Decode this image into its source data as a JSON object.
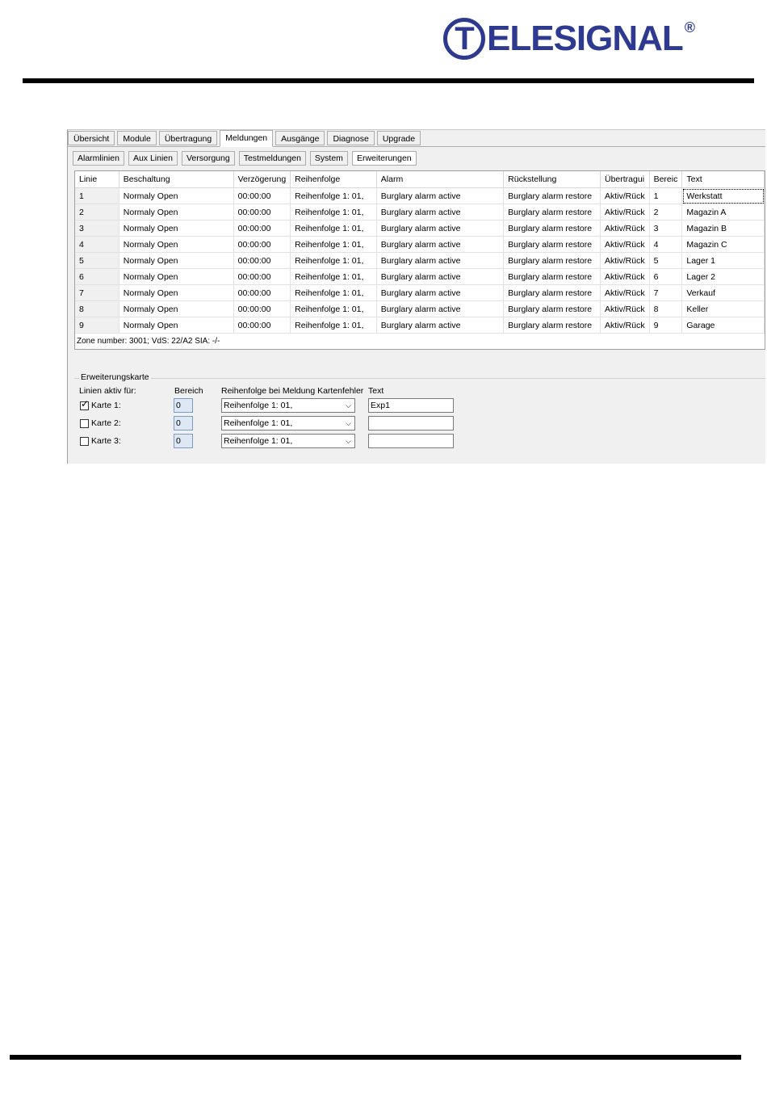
{
  "logo": {
    "letter": "T",
    "rest": "ELESIGNAL",
    "reg": "®"
  },
  "tabs_main": [
    {
      "label": "Übersicht",
      "active": false
    },
    {
      "label": "Module",
      "active": false
    },
    {
      "label": "Übertragung",
      "active": false
    },
    {
      "label": "Meldungen",
      "active": true
    },
    {
      "label": "Ausgänge",
      "active": false
    },
    {
      "label": "Diagnose",
      "active": false
    },
    {
      "label": "Upgrade",
      "active": false
    }
  ],
  "tabs_sub": [
    {
      "label": "Alarmlinien",
      "active": false
    },
    {
      "label": "Aux Linien",
      "active": false
    },
    {
      "label": "Versorgung",
      "active": false
    },
    {
      "label": "Testmeldungen",
      "active": false
    },
    {
      "label": "System",
      "active": false
    },
    {
      "label": "Erweiterungen",
      "active": true
    }
  ],
  "grid": {
    "columns": [
      "Linie",
      "Beschaltung",
      "Verzögerung",
      "Reihenfolge",
      "Alarm",
      "Rückstellung",
      "Übertragui",
      "Bereic",
      "Text"
    ],
    "rows": [
      [
        "1",
        "Normaly Open",
        "00:00:00",
        "Reihenfolge 1: 01,",
        "Burglary alarm active",
        "Burglary alarm restore",
        "Aktiv/Rück",
        "1",
        "Werkstatt"
      ],
      [
        "2",
        "Normaly Open",
        "00:00:00",
        "Reihenfolge 1: 01,",
        "Burglary alarm active",
        "Burglary alarm restore",
        "Aktiv/Rück",
        "2",
        "Magazin A"
      ],
      [
        "3",
        "Normaly Open",
        "00:00:00",
        "Reihenfolge 1: 01,",
        "Burglary alarm active",
        "Burglary alarm restore",
        "Aktiv/Rück",
        "3",
        "Magazin B"
      ],
      [
        "4",
        "Normaly Open",
        "00:00:00",
        "Reihenfolge 1: 01,",
        "Burglary alarm active",
        "Burglary alarm restore",
        "Aktiv/Rück",
        "4",
        "Magazin C"
      ],
      [
        "5",
        "Normaly Open",
        "00:00:00",
        "Reihenfolge 1: 01,",
        "Burglary alarm active",
        "Burglary alarm restore",
        "Aktiv/Rück",
        "5",
        "Lager 1"
      ],
      [
        "6",
        "Normaly Open",
        "00:00:00",
        "Reihenfolge 1: 01,",
        "Burglary alarm active",
        "Burglary alarm restore",
        "Aktiv/Rück",
        "6",
        "Lager 2"
      ],
      [
        "7",
        "Normaly Open",
        "00:00:00",
        "Reihenfolge 1: 01,",
        "Burglary alarm active",
        "Burglary alarm restore",
        "Aktiv/Rück",
        "7",
        "Verkauf"
      ],
      [
        "8",
        "Normaly Open",
        "00:00:00",
        "Reihenfolge 1: 01,",
        "Burglary alarm active",
        "Burglary alarm restore",
        "Aktiv/Rück",
        "8",
        "Keller"
      ],
      [
        "9",
        "Normaly Open",
        "00:00:00",
        "Reihenfolge 1: 01,",
        "Burglary alarm active",
        "Burglary alarm restore",
        "Aktiv/Rück",
        "9",
        "Garage"
      ]
    ],
    "status": "Zone number: 3001;   VdS: 22/A2   SIA: -/-"
  },
  "expansion": {
    "title": "Erweiterungskarte",
    "hdr_lines": "Linien aktiv für:",
    "hdr_area": "Bereich",
    "hdr_sequence": "Reihenfolge bei Meldung Kartenfehler",
    "hdr_text": "Text",
    "cards": [
      {
        "label": "Karte 1:",
        "checked": true,
        "area": "0",
        "sequence": "Reihenfolge 1: 01,",
        "text": "Exp1"
      },
      {
        "label": "Karte 2:",
        "checked": false,
        "area": "0",
        "sequence": "Reihenfolge 1: 01,",
        "text": ""
      },
      {
        "label": "Karte 3:",
        "checked": false,
        "area": "0",
        "sequence": "Reihenfolge 1: 01,",
        "text": ""
      }
    ]
  }
}
